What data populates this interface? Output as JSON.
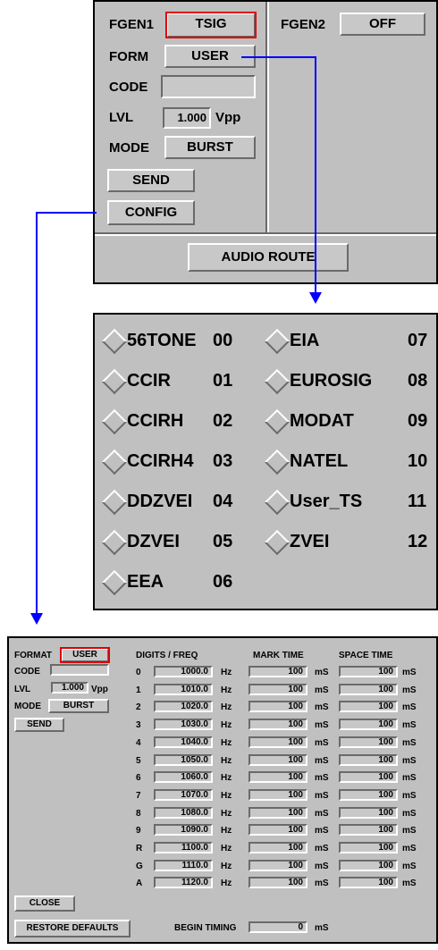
{
  "top_panel": {
    "fgen1_label": "FGEN1",
    "fgen1_value": "TSIG",
    "fgen2_label": "FGEN2",
    "fgen2_value": "OFF",
    "form_label": "FORM",
    "form_value": "USER",
    "code_label": "CODE",
    "code_value": "",
    "lvl_label": "LVL",
    "lvl_value": "1.000",
    "lvl_unit": "Vpp",
    "mode_label": "MODE",
    "mode_value": "BURST",
    "send_label": "SEND",
    "config_label": "CONFIG",
    "audio_route_label": "AUDIO ROUTE"
  },
  "form_list": {
    "items": [
      {
        "name": "56TONE",
        "code": "00"
      },
      {
        "name": "CCIR",
        "code": "01"
      },
      {
        "name": "CCIRH",
        "code": "02"
      },
      {
        "name": "CCIRH4",
        "code": "03"
      },
      {
        "name": "DDZVEI",
        "code": "04"
      },
      {
        "name": "DZVEI",
        "code": "05"
      },
      {
        "name": "EEA",
        "code": "06"
      },
      {
        "name": "EIA",
        "code": "07"
      },
      {
        "name": "EUROSIG",
        "code": "08"
      },
      {
        "name": "MODAT",
        "code": "09"
      },
      {
        "name": "NATEL",
        "code": "10"
      },
      {
        "name": "User_TS",
        "code": "11"
      },
      {
        "name": "ZVEI",
        "code": "12"
      }
    ]
  },
  "config_panel": {
    "format_label": "FORMAT",
    "format_value": "USER",
    "code_label": "CODE",
    "code_value": "",
    "lvl_label": "LVL",
    "lvl_value": "1.000",
    "lvl_unit": "Vpp",
    "mode_label": "MODE",
    "mode_value": "BURST",
    "send_label": "SEND",
    "close_label": "CLOSE",
    "restore_label": "RESTORE DEFAULTS",
    "col_digits": "DIGITS / FREQ",
    "col_mark": "MARK TIME",
    "col_space": "SPACE TIME",
    "freq_unit": "Hz",
    "time_unit": "mS",
    "rows": [
      {
        "digit": "0",
        "freq": "1000.0",
        "mark": "100",
        "space": "100"
      },
      {
        "digit": "1",
        "freq": "1010.0",
        "mark": "100",
        "space": "100"
      },
      {
        "digit": "2",
        "freq": "1020.0",
        "mark": "100",
        "space": "100"
      },
      {
        "digit": "3",
        "freq": "1030.0",
        "mark": "100",
        "space": "100"
      },
      {
        "digit": "4",
        "freq": "1040.0",
        "mark": "100",
        "space": "100"
      },
      {
        "digit": "5",
        "freq": "1050.0",
        "mark": "100",
        "space": "100"
      },
      {
        "digit": "6",
        "freq": "1060.0",
        "mark": "100",
        "space": "100"
      },
      {
        "digit": "7",
        "freq": "1070.0",
        "mark": "100",
        "space": "100"
      },
      {
        "digit": "8",
        "freq": "1080.0",
        "mark": "100",
        "space": "100"
      },
      {
        "digit": "9",
        "freq": "1090.0",
        "mark": "100",
        "space": "100"
      },
      {
        "digit": "R",
        "freq": "1100.0",
        "mark": "100",
        "space": "100"
      },
      {
        "digit": "G",
        "freq": "1110.0",
        "mark": "100",
        "space": "100"
      },
      {
        "digit": "A",
        "freq": "1120.0",
        "mark": "100",
        "space": "100"
      }
    ],
    "begin_timing_label": "BEGIN TIMING",
    "begin_timing_value": "0",
    "begin_timing_unit": "mS"
  },
  "colors": {
    "panel_bg": "#c0c0c0",
    "highlight": "#e00000",
    "connector": "#0000ff"
  }
}
